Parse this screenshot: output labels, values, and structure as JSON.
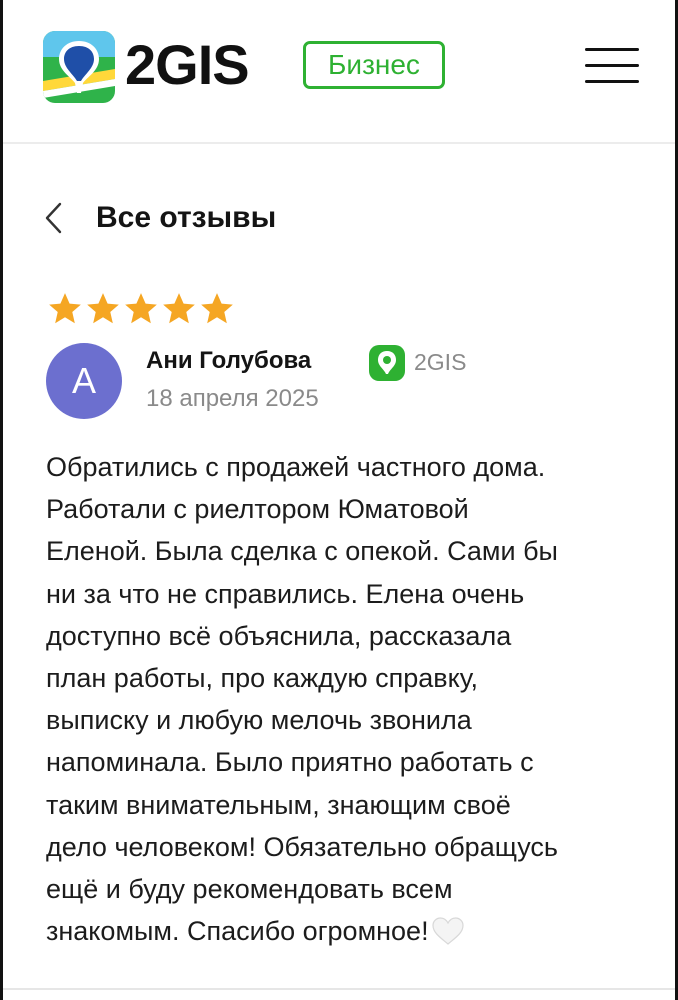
{
  "header": {
    "logo_text": "2GIS",
    "business_badge": "Бизнес",
    "icons": {
      "logo": "2gis-logo-icon",
      "menu": "hamburger-menu-icon"
    },
    "brand_color": "#2eb132"
  },
  "navigation": {
    "back_label": "Все отзывы",
    "back_icon": "chevron-left-icon"
  },
  "review": {
    "rating": 5,
    "rating_max": 5,
    "star_color": "#f5a623",
    "author": {
      "initial": "А",
      "name": "Ани Голубова",
      "avatar_color": "#6c6fcf"
    },
    "source": {
      "label": "2GIS",
      "icon": "2gis-source-icon"
    },
    "date": "18 апреля 2025",
    "text_lines": [
      "Обратились с продажей частного дома.",
      "Работали с риелтором Юматовой",
      "Еленой. Была сделка с опекой. Сами бы",
      "ни за что не справились. Елена очень",
      "доступно всё объяснила, рассказала",
      "план работы, про каждую справку,",
      "выписку и любую мелочь звонила",
      "напоминала. Было приятно работать с",
      "таким внимательным, знающим своё",
      "дело человеком! Обязательно обращусь",
      "ещё и буду рекомендовать всем",
      "знакомым. Спасибо огромное!"
    ],
    "emoji_icon": "white-heart-icon"
  }
}
